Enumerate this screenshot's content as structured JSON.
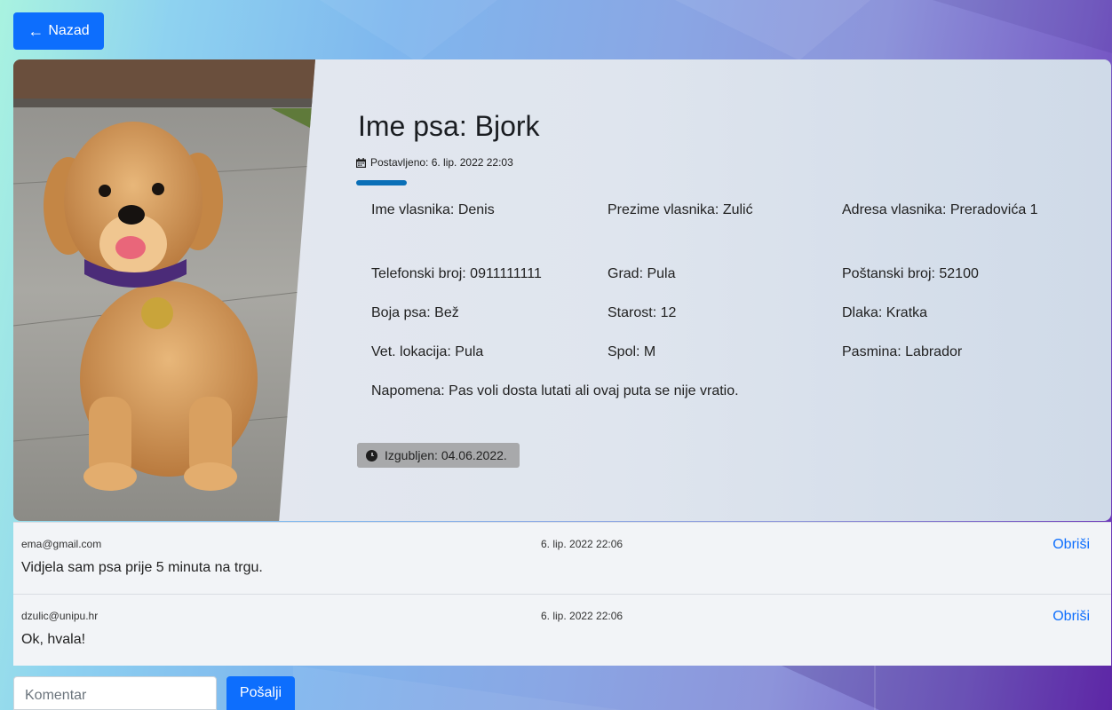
{
  "nav": {
    "back_label": "Nazad"
  },
  "dog": {
    "title": "Ime psa: Bjork",
    "posted": "Postavljeno: 6. lip. 2022 22:03",
    "fields": [
      {
        "text": "Ime vlasnika: Denis"
      },
      {
        "text": "Prezime vlasnika: Zulić"
      },
      {
        "text": "Adresa  vlasnika:  Preradovića 1"
      },
      {
        "text": "Telefonski broj: 0911111111"
      },
      {
        "text": "Grad: Pula"
      },
      {
        "text": "Poštanski broj: 52100"
      },
      {
        "text": "Boja psa: Bež"
      },
      {
        "text": "Starost: 12"
      },
      {
        "text": "Dlaka: Kratka"
      },
      {
        "text": "Vet. lokacija: Pula"
      },
      {
        "text": "Spol: M"
      },
      {
        "text": "Pasmina: Labrador"
      },
      {
        "text": "Napomena: Pas voli dosta lutati ali ovaj puta se nije vratio."
      }
    ],
    "lost_badge": "Izgubljen: 04.06.2022."
  },
  "comments": [
    {
      "author": "ema@gmail.com",
      "date": "6. lip. 2022 22:06",
      "text": "Vidjela sam psa prije 5 minuta na trgu.",
      "delete_label": "Obriši"
    },
    {
      "author": "dzulic@unipu.hr",
      "date": "6. lip. 2022 22:06",
      "text": "Ok, hvala!",
      "delete_label": "Obriši"
    }
  ],
  "comment_form": {
    "placeholder": "Komentar",
    "send_label": "Pošalji"
  },
  "colors": {
    "primary": "#0d6efd",
    "accent_bar": "#0a6fb7",
    "badge_bg": "#a8a9ab"
  },
  "icons": {
    "back": "arrow-left-icon",
    "posted": "calendar-icon",
    "lost": "clock-icon"
  }
}
